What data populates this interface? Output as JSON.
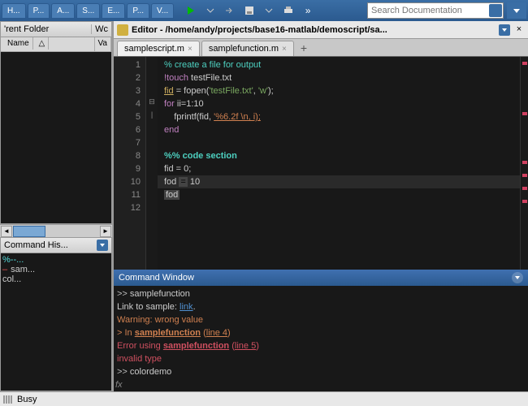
{
  "topbar": {
    "tabs": [
      "H...",
      "P...",
      "A...",
      "S...",
      "E...",
      "P...",
      "V..."
    ],
    "search_placeholder": "Search Documentation"
  },
  "folder_panel": {
    "title_left": "'rent Folder",
    "title_right": "Wc",
    "columns": {
      "name": "Name",
      "sort": "△",
      "value": "Va"
    }
  },
  "history_panel": {
    "title": "Command His...",
    "items": [
      {
        "text": "%--...",
        "cls": "cyan"
      },
      {
        "text": "sam...",
        "cls": "red"
      },
      {
        "text": "col...",
        "cls": ""
      }
    ]
  },
  "editor": {
    "icon_label": "📝",
    "title": "Editor - /home/andy/projects/base16-matlab/demoscript/sa...",
    "close": "×",
    "dropdown": "▼",
    "tabs": [
      {
        "label": "samplescript.m",
        "active": true
      },
      {
        "label": "samplefunction.m",
        "active": false
      }
    ],
    "add": "+",
    "lines": [
      {
        "n": 1,
        "html": "<span class='c-comment'>% create a file for output</span>"
      },
      {
        "n": 2,
        "html": "<span class='c-bang'>!touch</span> <span class='c-plain'>testFile.txt</span>"
      },
      {
        "n": 3,
        "html": "<span class='c-var' style='text-decoration:underline'>fid</span> <span class='c-plain'>= fopen(</span><span class='c-str'>'testFile.txt'</span><span class='c-plain'>, </span><span class='c-str'>'w'</span><span class='c-plain'>);</span>"
      },
      {
        "n": 4,
        "fold": "⊟",
        "html": "<span class='c-kw'>for</span> <span class='c-plain'>ii=1:10</span>"
      },
      {
        "n": 5,
        "fold": "|",
        "html": "    <span class='c-plain'>fprintf(fid, </span><span class='c-fmt'>'%6.2f \\n, i);</span>"
      },
      {
        "n": 6,
        "html": "<span class='c-kw'>end</span>"
      },
      {
        "n": 7,
        "html": ""
      },
      {
        "n": 8,
        "html": "<span class='c-section'>%% code section</span>"
      },
      {
        "n": 9,
        "html": "<span class='c-plain'>fid = 0;</span>"
      },
      {
        "n": 10,
        "hl": true,
        "html": "<span class='c-plain'>fod </span><span class='c-box'>=</span><span class='c-plain'> 10</span>"
      },
      {
        "n": 11,
        "html": "<span class='c-box c-plain'>fod</span>"
      },
      {
        "n": 12,
        "html": ""
      }
    ],
    "minimap_marks": [
      6,
      68,
      128,
      144,
      160,
      176
    ]
  },
  "command_window": {
    "title": "Command Window",
    "lines": [
      "<span class='cw-prompt'>&gt;&gt; </span><span class='cw-plain'>samplefunction</span>",
      "<span class='cw-plain'>Link to sample: </span><span class='cw-link'>link</span><span class='cw-plain'>.</span>",
      "<span class='cw-warn'>Warning: wrong value</span>",
      "<span class='cw-warn'>&gt; In </span><span class='cw-warn cw-ul'>samplefunction</span><span class='cw-warn'> (</span><span class='cw-warn' style='text-decoration:underline'>line 4</span><span class='cw-warn'>)</span>",
      "<span class='cw-err'>Error using </span><span class='cw-err cw-ul'>samplefunction</span><span class='cw-err'> (</span><span class='cw-err' style='text-decoration:underline'>line 5</span><span class='cw-err'>)</span>",
      "<span class='cw-err'>invalid type</span>",
      "<span class='cw-prompt'>&gt;&gt; </span><span class='cw-plain'>colordemo</span>"
    ],
    "fx": "fx"
  },
  "status": {
    "text": "Busy"
  },
  "colors": {
    "accent": "#3a6ea5",
    "bg_dark": "#181818"
  }
}
